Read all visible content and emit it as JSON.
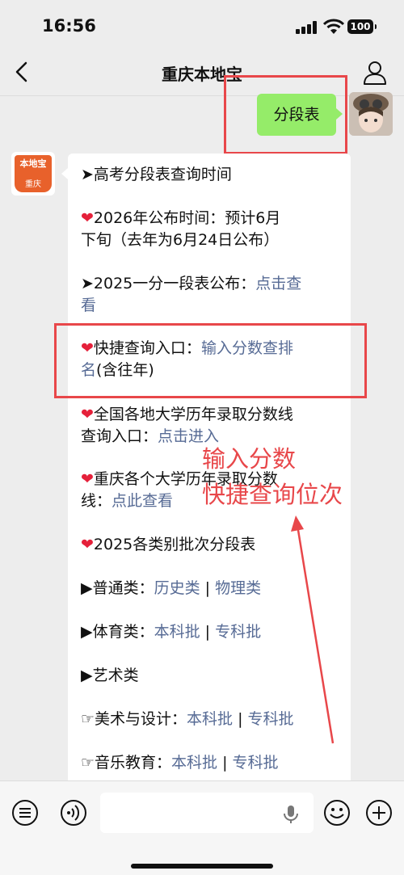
{
  "status": {
    "time": "16:56",
    "battery": "100"
  },
  "nav": {
    "title": "重庆本地宝"
  },
  "my_message": {
    "text": "分段表"
  },
  "logo": {
    "top": "本地宝",
    "bottom": "重庆"
  },
  "lines": {
    "l1": "➤高考分段表查询时间",
    "l2a": "2026年公布时间：预计6月",
    "l2b": "下旬（去年为6月24日公布）",
    "l3a": "➤2025一分一段表公布：",
    "l3link_a": "点击查",
    "l3link_b": "看",
    "l4a": "快捷查询入口：",
    "l4link_a": "输入分数查排",
    "l4link_b": "名",
    "l4b": "(含往年)",
    "l5a": "全国各地大学历年录取分数线",
    "l5b": "查询入口：",
    "l5link": "点击进入",
    "l6a": "重庆各个大学历年录取分数",
    "l6b": "线：",
    "l6link": "点此查看",
    "l7": "2025各类别批次分段表",
    "l8a": "▶普通类：",
    "l8link1": "历史类",
    "l8sep": " | ",
    "l8link2": "物理类",
    "l9a": "▶体育类：",
    "l9link1": "本科批",
    "l9sep": " | ",
    "l9link2": "专科批",
    "l10": "▶艺术类",
    "l11a": "☞美术与设计：",
    "l11link1": "本科批",
    "l11sep": " | ",
    "l11link2": "专科批",
    "l12a": "☞音乐教育：",
    "l12link1": "本科批",
    "l12sep": " | ",
    "l12link2": "专科批"
  },
  "annotation": {
    "line1": "输入分数",
    "line2": "快捷查询位次"
  },
  "colors": {
    "accent_red": "#e8474a",
    "link": "#576b95",
    "bubble_green": "#95ec69"
  },
  "icons": [
    "back-icon",
    "profile-icon",
    "voice-list-icon",
    "voice-icon",
    "mic-icon",
    "emoji-icon",
    "plus-icon"
  ]
}
